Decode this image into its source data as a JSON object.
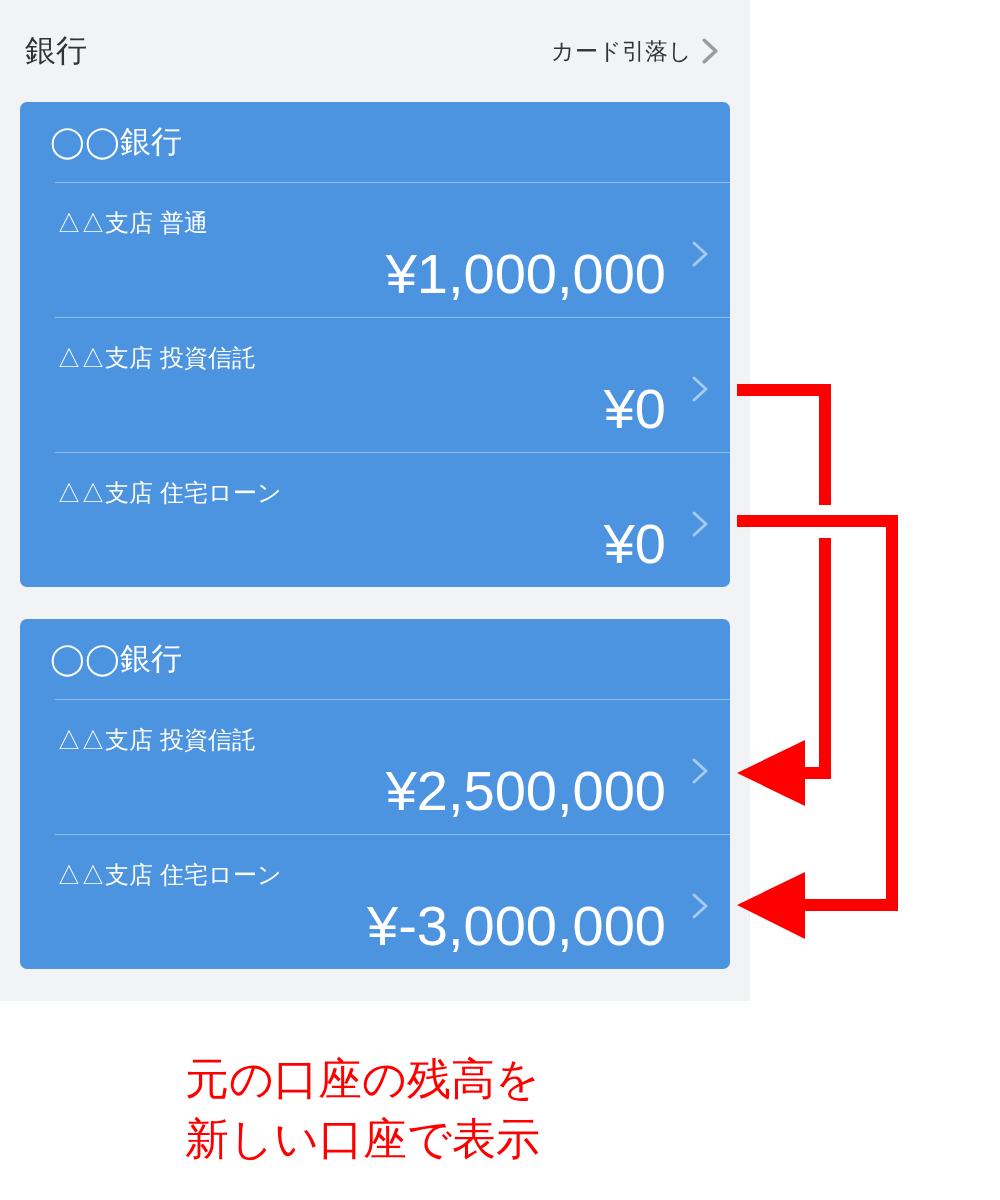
{
  "header": {
    "title": "銀行",
    "link": "カード引落し"
  },
  "banks": [
    {
      "name": "◯◯銀行",
      "accounts": [
        {
          "label": "△△支店 普通",
          "balance": "¥1,000,000"
        },
        {
          "label": "△△支店 投資信託",
          "balance": "¥0"
        },
        {
          "label": "△△支店 住宅ローン",
          "balance": "¥0"
        }
      ]
    },
    {
      "name": "◯◯銀行",
      "accounts": [
        {
          "label": "△△支店 投資信託",
          "balance": "¥2,500,000"
        },
        {
          "label": "△△支店 住宅ローン",
          "balance": "¥-3,000,000"
        }
      ]
    }
  ],
  "annotation": {
    "caption": "元の口座の残高を新しい口座で表示"
  }
}
